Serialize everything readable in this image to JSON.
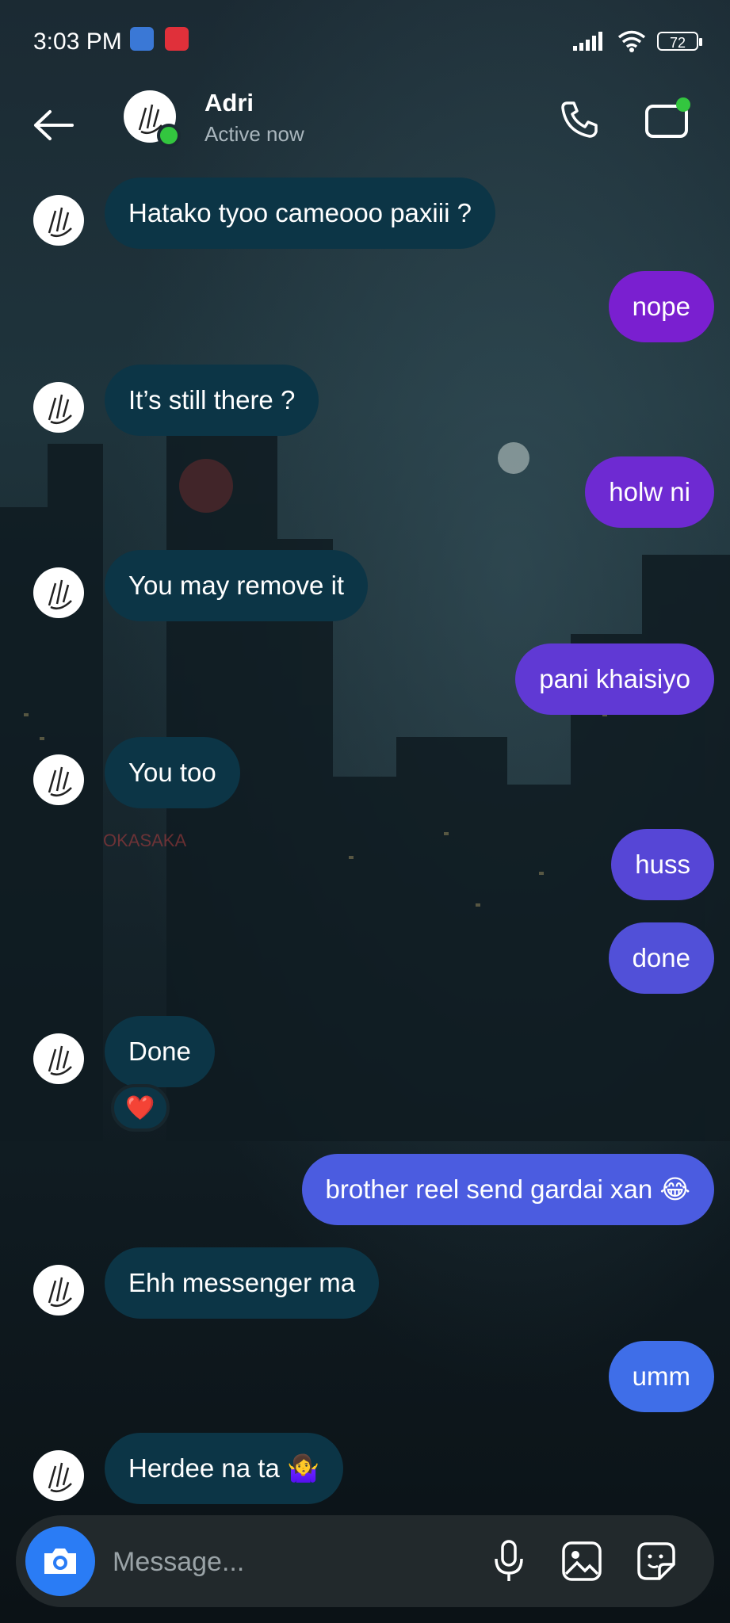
{
  "status_bar": {
    "time": "3:03 PM",
    "battery": "72"
  },
  "header": {
    "name": "Adri",
    "status": "Active now"
  },
  "messages": [
    {
      "dir": "in",
      "text": "Hatako tyoo cameooo paxiii ?"
    },
    {
      "dir": "out",
      "text": "nope",
      "color": "#7a1fd0"
    },
    {
      "dir": "in",
      "text": "It’s still there ?"
    },
    {
      "dir": "out",
      "text": "holw ni",
      "color": "#6e2ad2"
    },
    {
      "dir": "in",
      "text": "You may remove it"
    },
    {
      "dir": "out",
      "text": "pani khaisiyo",
      "color": "#6039d4"
    },
    {
      "dir": "in",
      "text": "You too"
    },
    {
      "dir": "out",
      "text": "huss",
      "color": "#5646d6"
    },
    {
      "dir": "out",
      "text": "done",
      "color": "#5150d8"
    },
    {
      "dir": "in",
      "text": "Done",
      "reaction": "❤️"
    },
    {
      "dir": "out",
      "text": "brother reel send gardai xan 😂",
      "color": "#4b5ce0"
    },
    {
      "dir": "in",
      "text": "Ehh messenger ma"
    },
    {
      "dir": "out",
      "text": "umm",
      "color": "#3f6ee8"
    },
    {
      "dir": "in",
      "text": "Herdee na ta 🤷‍♀️"
    }
  ],
  "composer": {
    "placeholder": "Message..."
  },
  "colors": {
    "incoming_bubble": "#0c3546",
    "camera_button": "#2a7cf5",
    "online": "#33c63f"
  }
}
